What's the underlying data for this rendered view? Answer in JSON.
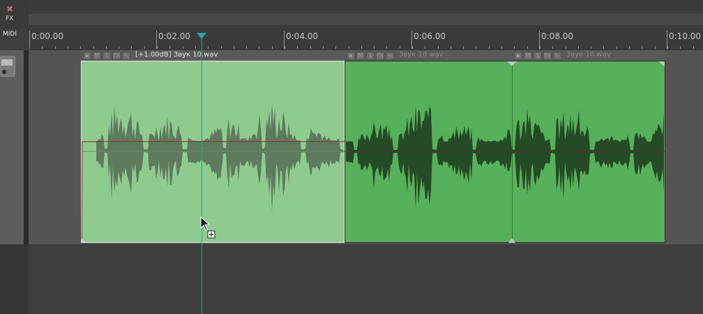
{
  "tcp": {
    "fx_label": "FX",
    "midi_label": "MIDI"
  },
  "ruler": {
    "labels": [
      "0:00.00",
      "0:02.00",
      "0:04.00",
      "0:06.00",
      "0:08.00",
      "0:10.00"
    ]
  },
  "items": [
    {
      "name": "[+1.00dB] Звук 10.wav",
      "selected": true
    },
    {
      "name": "Звук 10.wav",
      "selected": false
    },
    {
      "name": "Звук 10.wav",
      "selected": false
    }
  ],
  "item_buttons": [
    "🔒",
    "M",
    "1",
    "FX",
    "∿"
  ],
  "colors": {
    "item_selected": "#8fcb8f",
    "item_normal": "#57b05a",
    "waveform_selected": "#5e7b5e",
    "waveform_normal": "#244a26",
    "playhead": "#1f9f93",
    "envelope": "#8a2a2a"
  },
  "icons": [
    "close-x-icon",
    "track-icon",
    "playhead-marker-icon",
    "mouse-cursor-icon",
    "copy-plus-icon"
  ]
}
